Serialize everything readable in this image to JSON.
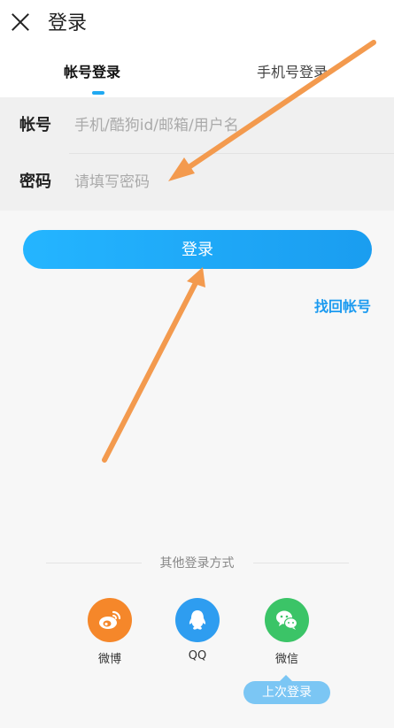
{
  "header": {
    "title": "登录",
    "close_icon": "close-icon"
  },
  "tabs": [
    {
      "label": "帐号登录",
      "active": true
    },
    {
      "label": "手机号登录",
      "active": false
    }
  ],
  "form": {
    "account": {
      "label": "帐号",
      "placeholder": "手机/酷狗id/邮箱/用户名",
      "value": ""
    },
    "password": {
      "label": "密码",
      "placeholder": "请填写密码",
      "value": ""
    }
  },
  "login_button": "登录",
  "recover_link": "找回帐号",
  "other_login": {
    "title": "其他登录方式",
    "options": [
      {
        "label": "微博",
        "icon": "weibo-icon",
        "color": "#f5872a"
      },
      {
        "label": "QQ",
        "icon": "qq-icon",
        "color": "#2e9df0"
      },
      {
        "label": "微信",
        "icon": "wechat-icon",
        "color": "#3bc467"
      }
    ],
    "last_login_badge": "上次登录"
  },
  "colors": {
    "accent": "#1fa9f2",
    "annotation_arrow": "#f39a4e"
  }
}
